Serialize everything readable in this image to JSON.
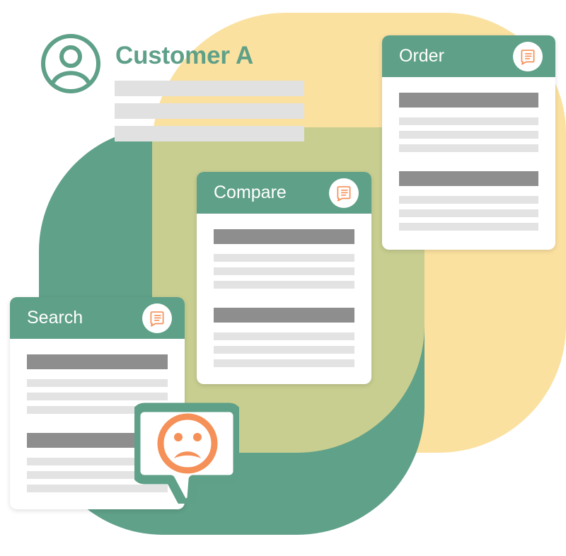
{
  "illustration": {
    "title": "Customer A",
    "theme_colors": {
      "green": "#5FA088",
      "yellow": "#FBE1A0",
      "olive": "#C8CE90",
      "orange": "#F59058",
      "bar_strong": "#8E8E8E",
      "bar_light": "#E3E3E3",
      "white": "#FFFFFF"
    }
  },
  "header": {
    "avatar_icon": "user-avatar-icon",
    "title": "Customer A",
    "placeholder_bars": [
      {
        "name": "line-1"
      },
      {
        "name": "line-2"
      },
      {
        "name": "line-3"
      }
    ]
  },
  "cards": [
    {
      "id": "order",
      "title": "Order",
      "badge_icon": "document-note-icon",
      "body": [
        {
          "type": "strong"
        },
        {
          "type": "light"
        },
        {
          "type": "light"
        },
        {
          "type": "light"
        },
        {
          "type": "gap"
        },
        {
          "type": "strong"
        },
        {
          "type": "light"
        },
        {
          "type": "light"
        },
        {
          "type": "light"
        }
      ]
    },
    {
      "id": "compare",
      "title": "Compare",
      "badge_icon": "document-note-icon",
      "body": [
        {
          "type": "strong"
        },
        {
          "type": "light"
        },
        {
          "type": "light"
        },
        {
          "type": "light"
        },
        {
          "type": "gap"
        },
        {
          "type": "strong"
        },
        {
          "type": "light"
        },
        {
          "type": "light"
        },
        {
          "type": "light"
        }
      ]
    },
    {
      "id": "search",
      "title": "Search",
      "badge_icon": "document-note-icon",
      "body": [
        {
          "type": "strong"
        },
        {
          "type": "light"
        },
        {
          "type": "light"
        },
        {
          "type": "light"
        },
        {
          "type": "gap"
        },
        {
          "type": "strong"
        },
        {
          "type": "light"
        },
        {
          "type": "light"
        },
        {
          "type": "light"
        }
      ]
    }
  ],
  "feedback": {
    "bubble_icon": "speech-bubble-icon",
    "face_icon": "sad-face-icon",
    "sentiment": "negative"
  }
}
